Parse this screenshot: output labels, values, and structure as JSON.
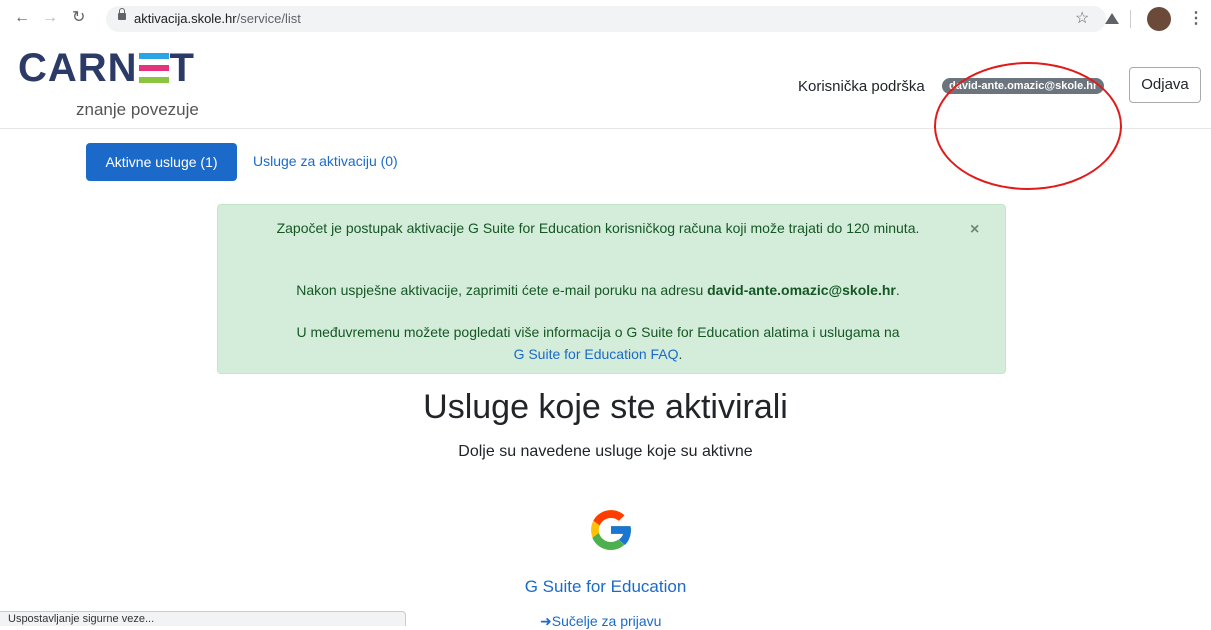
{
  "browser": {
    "url_domain": "aktivacija.skole.hr",
    "url_path": "/service/list",
    "status_text": "Uspostavljanje sigurne veze..."
  },
  "header": {
    "logo_text_left": "CARN",
    "logo_text_right": "T",
    "logo_bar_colors": [
      "#2aa4e4",
      "#e4327c",
      "#8bc53f"
    ],
    "tagline": "znanje povezuje",
    "support_label": "Korisnička podrška",
    "user_email": "david-ante.omazic@skole.hr",
    "logout_label": "Odjava"
  },
  "tabs": {
    "active_label": "Aktivne usluge (1)",
    "pending_label": "Usluge za aktivaciju (0)"
  },
  "alert": {
    "line1": "Započet je postupak aktivacije G Suite for Education korisničkog računa koji može trajati do 120 minuta.",
    "line2_prefix": "Nakon uspješne aktivacije, zaprimiti ćete e-mail poruku na adresu ",
    "line2_email": "david-ante.omazic@skole.hr",
    "line2_suffix": ".",
    "line3_prefix": "U međuvremenu možete pogledati više informacija o G Suite for Education alatima i uslugama na",
    "line3_link": "G Suite for Education FAQ",
    "line3_suffix": ".",
    "close_symbol": "×"
  },
  "main": {
    "title": "Usluge koje ste aktivirali",
    "subtitle": "Dolje su navedene usluge koje su aktivne",
    "service_name": "G Suite for Education",
    "login_link": "Sučelje za prijavu"
  },
  "colors": {
    "primary": "#1b6ac9",
    "alert_bg": "#d4edda",
    "highlight": "#e01b1b"
  }
}
